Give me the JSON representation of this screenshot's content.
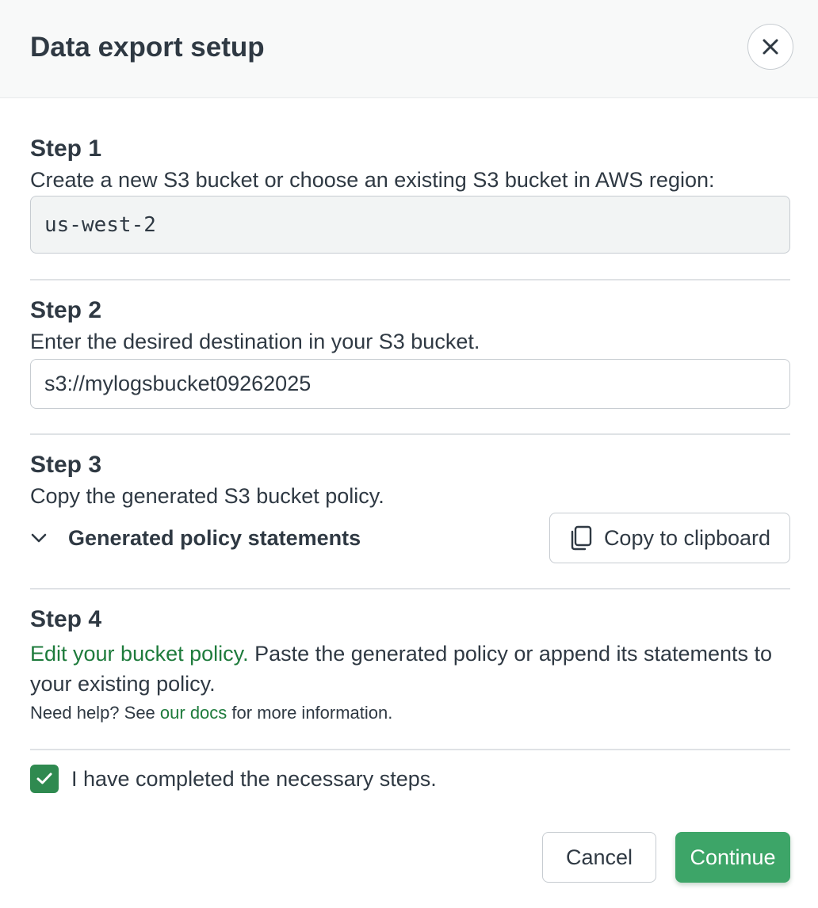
{
  "header": {
    "title": "Data export setup",
    "close_icon": "close-icon"
  },
  "step1": {
    "title": "Step 1",
    "description": "Create a new S3 bucket or choose an existing S3 bucket in AWS region:",
    "region_value": "us-west-2"
  },
  "step2": {
    "title": "Step 2",
    "description": "Enter the desired destination in your S3 bucket.",
    "destination_value": "s3://mylogsbucket09262025",
    "destination_placeholder": ""
  },
  "step3": {
    "title": "Step 3",
    "description": "Copy the generated S3 bucket policy.",
    "policy_toggle_label": "Generated policy statements",
    "copy_button_label": "Copy to clipboard",
    "chevron_icon": "chevron-down-icon",
    "copy_icon": "copy-icon"
  },
  "step4": {
    "title": "Step 4",
    "edit_link": "Edit your bucket policy.",
    "description_rest": " Paste the generated policy or append its statements to your existing policy.",
    "help_prefix": "Need help? See ",
    "docs_link": "our docs",
    "help_suffix": " for more information."
  },
  "confirmation": {
    "checked": true,
    "label": "I have completed the necessary steps.",
    "check_icon": "checkmark-icon"
  },
  "footer": {
    "cancel_label": "Cancel",
    "continue_label": "Continue"
  },
  "colors": {
    "text": "#2f3943",
    "link": "#1e7b3c",
    "primary": "#3da568",
    "checkbox": "#2f8a50",
    "border": "#c7ccd1",
    "header_bg": "#f8f9f9"
  }
}
